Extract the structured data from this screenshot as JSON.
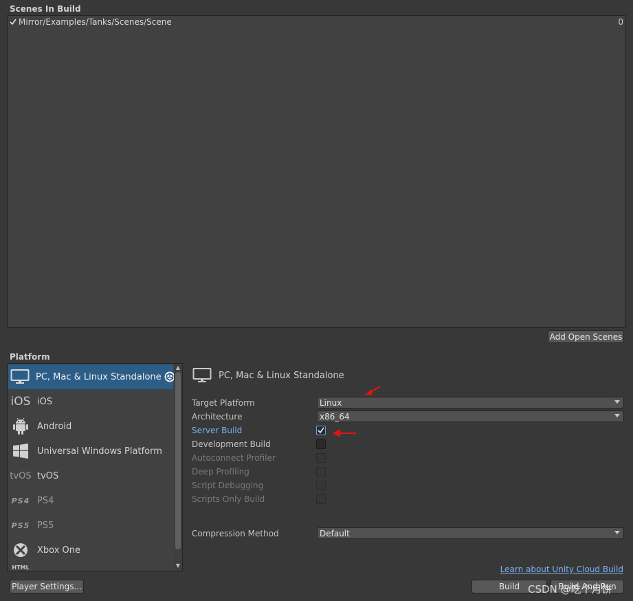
{
  "scenes": {
    "title": "Scenes In Build",
    "items": [
      {
        "checked": true,
        "path": "Mirror/Examples/Tanks/Scenes/Scene",
        "index": "0"
      }
    ],
    "add_open_scenes_label": "Add Open Scenes"
  },
  "platform": {
    "title": "Platform",
    "items": [
      {
        "label": "PC, Mac & Linux Standalone",
        "icon": "monitor-icon",
        "selected": true,
        "active": true
      },
      {
        "label": "iOS",
        "icon": "ios-icon"
      },
      {
        "label": "Android",
        "icon": "android-icon"
      },
      {
        "label": "Universal Windows Platform",
        "icon": "windows-icon"
      },
      {
        "label": "tvOS",
        "icon": "tvos-icon"
      },
      {
        "label": "PS4",
        "icon": "ps4-icon"
      },
      {
        "label": "PS5",
        "icon": "ps5-icon"
      },
      {
        "label": "Xbox One",
        "icon": "xbox-icon"
      }
    ]
  },
  "settings": {
    "header": "PC, Mac & Linux Standalone",
    "target_platform": {
      "label": "Target Platform",
      "value": "Linux"
    },
    "architecture": {
      "label": "Architecture",
      "value": "x86_64"
    },
    "server_build": {
      "label": "Server Build",
      "checked": true
    },
    "development_build": {
      "label": "Development Build",
      "checked": false
    },
    "autoconnect_profiler": {
      "label": "Autoconnect Profiler",
      "checked": false
    },
    "deep_profiling": {
      "label": "Deep Profiling",
      "checked": false
    },
    "script_debugging": {
      "label": "Script Debugging",
      "checked": false
    },
    "scripts_only_build": {
      "label": "Scripts Only Build",
      "checked": false
    },
    "compression_method": {
      "label": "Compression Method",
      "value": "Default"
    }
  },
  "footer": {
    "player_settings_label": "Player Settings...",
    "cloud_build_link": "Learn about Unity Cloud Build",
    "build_label": "Build",
    "build_and_run_label": "Build And Run"
  },
  "watermark": "CSDN @吃个月饼",
  "colors": {
    "background": "#383838",
    "selection": "#2c5d87",
    "link": "#7ab3f2",
    "annotation_arrow": "#e21414"
  }
}
